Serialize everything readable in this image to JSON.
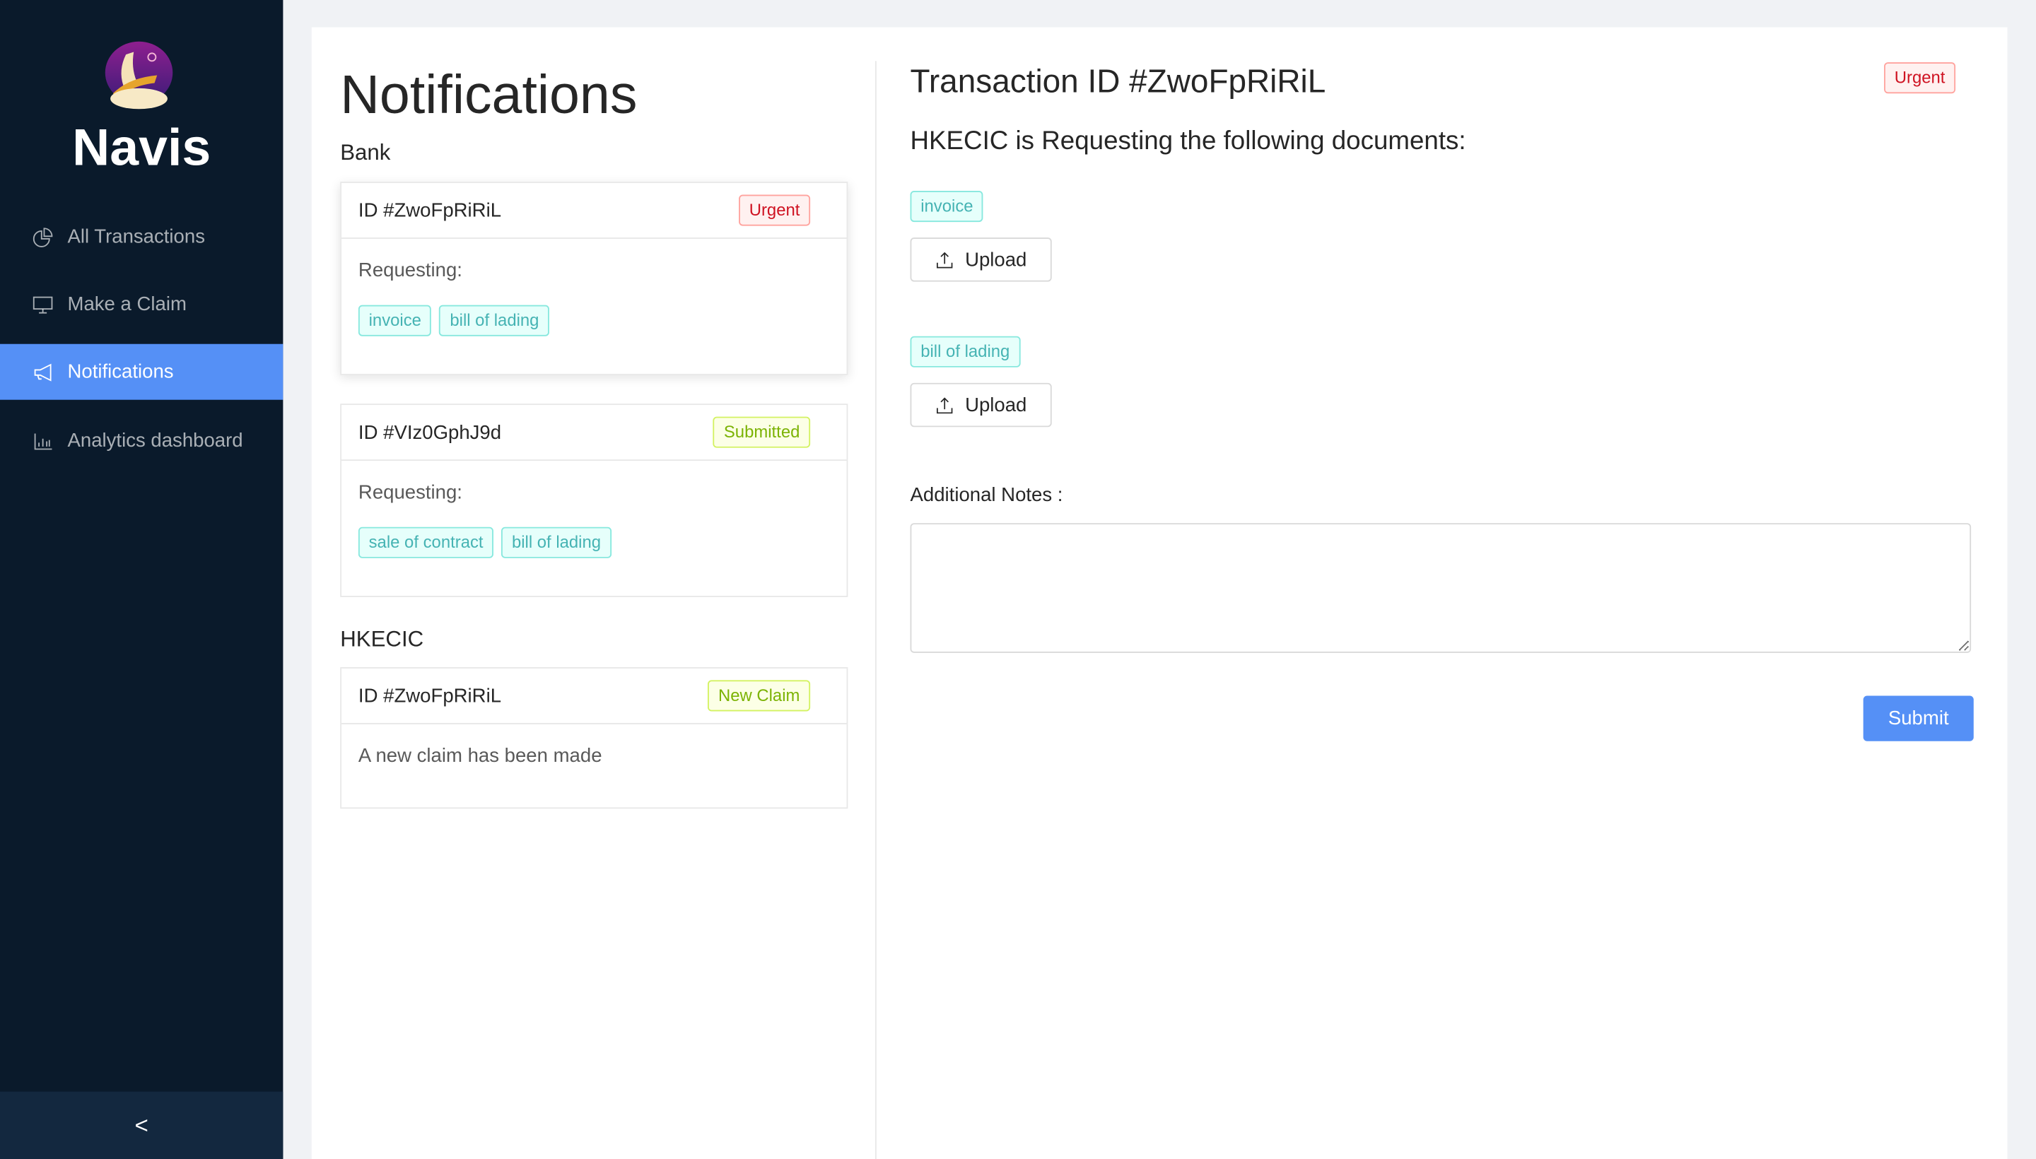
{
  "sidebar": {
    "brand": "Navis",
    "items": [
      {
        "label": "All Transactions",
        "icon": "pie-chart-icon"
      },
      {
        "label": "Make a Claim",
        "icon": "desktop-icon"
      },
      {
        "label": "Notifications",
        "icon": "megaphone-icon",
        "active": true
      },
      {
        "label": "Analytics dashboard",
        "icon": "bar-chart-icon"
      }
    ],
    "collapse": "<"
  },
  "list": {
    "title": "Notifications",
    "sections": [
      {
        "name": "Bank",
        "cards": [
          {
            "id": "ID #ZwoFpRiRiL",
            "status": "Urgent",
            "label": "Requesting:",
            "tags": [
              "invoice",
              "bill of lading"
            ]
          },
          {
            "id": "ID #VIz0GphJ9d",
            "status": "Submitted",
            "label": "Requesting:",
            "tags": [
              "sale of contract",
              "bill of lading"
            ]
          }
        ]
      },
      {
        "name": "HKECIC",
        "cards": [
          {
            "id": "ID #ZwoFpRiRiL",
            "status": "New Claim",
            "message": "A new claim has been made"
          }
        ]
      }
    ]
  },
  "detail": {
    "title": "Transaction ID #ZwoFpRiRiL",
    "status": "Urgent",
    "subtitle": "HKECIC is Requesting the following documents:",
    "documents": [
      {
        "name": "invoice",
        "button": "Upload"
      },
      {
        "name": "bill of lading",
        "button": "Upload"
      }
    ],
    "notes_label": "Additional Notes",
    "notes_value": "",
    "submit": "Submit"
  },
  "colors": {
    "sidebar": "#0a1a2b",
    "accent": "#5590f6",
    "urgent": "#cf1322",
    "submitted": "#7cb305",
    "tag": "#45b3b3"
  }
}
